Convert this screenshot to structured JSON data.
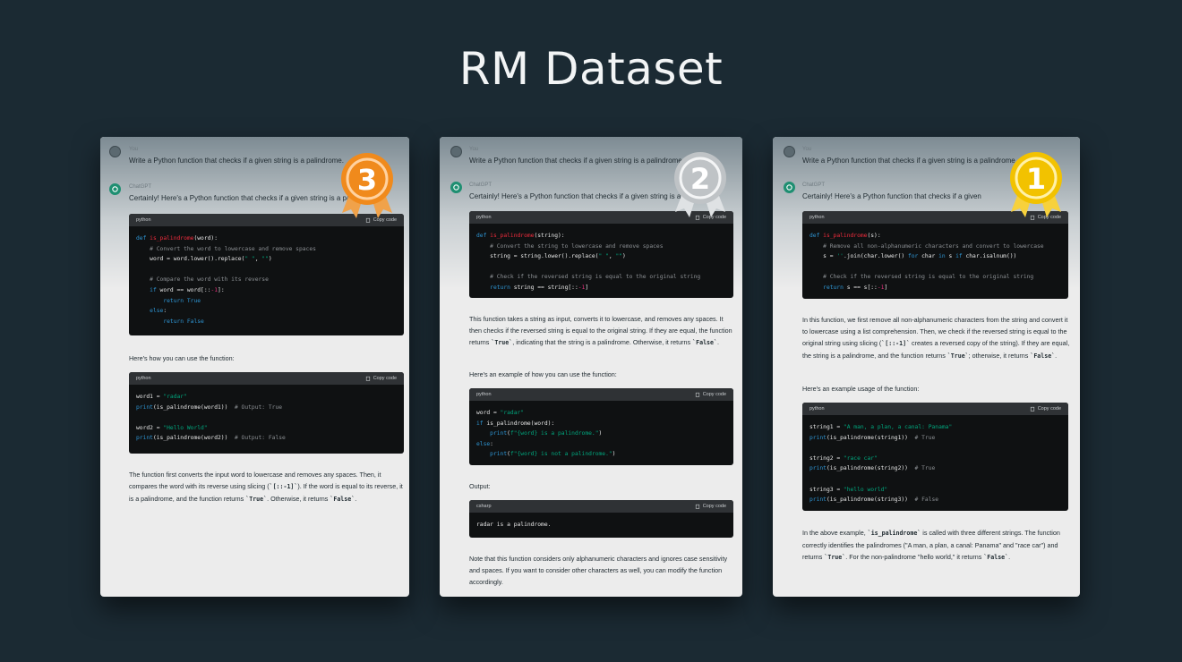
{
  "title": "RM Dataset",
  "colors": {
    "background": "#1b2a33",
    "gold": "#f2c200",
    "silver": "#bfc3c6",
    "bronze": "#f08a1c"
  },
  "cards": [
    {
      "rank": "3",
      "medal": "bronze-medal-icon",
      "user_label": "You",
      "prompt": "Write a Python function that checks if a given string is a palindrome.",
      "assistant_label": "ChatGPT",
      "intro": "Certainly! Here's a Python function that checks if a given string is a palin",
      "code1_lang": "python",
      "copy_label": "Copy code",
      "mid_text": "Here's how you can use the function:",
      "code2_lang": "python",
      "final_text_parts": [
        "The function first converts the input word to lowercase and removes any spaces. Then, it compares the word with its reverse using slicing (",
        "`[::-1]`",
        "). If the word is equal to its reverse, it is a palindrome, and the function returns ",
        "`True`",
        ". Otherwise, it returns ",
        "`False`",
        "."
      ]
    },
    {
      "rank": "2",
      "medal": "silver-medal-icon",
      "user_label": "You",
      "prompt": "Write a Python function that checks if a given string is a palindrome.",
      "assistant_label": "ChatGPT",
      "intro": "Certainly! Here's a Python function that checks if a given string is a palindrome:",
      "code1_lang": "python",
      "copy_label": "Copy code",
      "para1_parts": [
        "This function takes a string as input, converts it to lowercase, and removes any spaces. It then checks if the reversed string is equal to the original string. If they are equal, the function returns ",
        "`True`",
        ", indicating that the string is a palindrome. Otherwise, it returns ",
        "`False`",
        "."
      ],
      "mid_text": "Here's an example of how you can use the function:",
      "code2_lang": "python",
      "output_label": "Output:",
      "code3_lang": "csharp",
      "code3": "radar is a palindrome.",
      "final_text": "Note that this function considers only alphanumeric characters and ignores case sensitivity and spaces. If you want to consider other characters as well, you can modify the function accordingly."
    },
    {
      "rank": "1",
      "medal": "gold-medal-icon",
      "user_label": "You",
      "prompt": "Write a Python function that checks if a given string is a palindrome.",
      "assistant_label": "ChatGPT",
      "intro": "Certainly! Here's a Python function that checks if a given",
      "code1_lang": "python",
      "copy_label": "Copy code",
      "para1_parts": [
        "In this function, we first remove all non-alphanumeric characters from the string and convert it to lowercase using a list comprehension. Then, we check if the reversed string is equal to the original string using slicing (",
        "`[::-1]`",
        " creates a reversed copy of the string). If they are equal, the string is a palindrome, and the function returns ",
        "`True`",
        "; otherwise, it returns ",
        "`False`",
        "."
      ],
      "mid_text": "Here's an example usage of the function:",
      "code2_lang": "python",
      "final_text_parts": [
        "In the above example, ",
        "`is_palindrome`",
        " is called with three different strings. The function correctly identifies the palindromes (\"A man, a plan, a canal: Panama\" and \"race car\") and returns ",
        "`True`",
        ". For the non-palindrome \"hello world,\" it returns ",
        "`False`",
        "."
      ]
    }
  ]
}
